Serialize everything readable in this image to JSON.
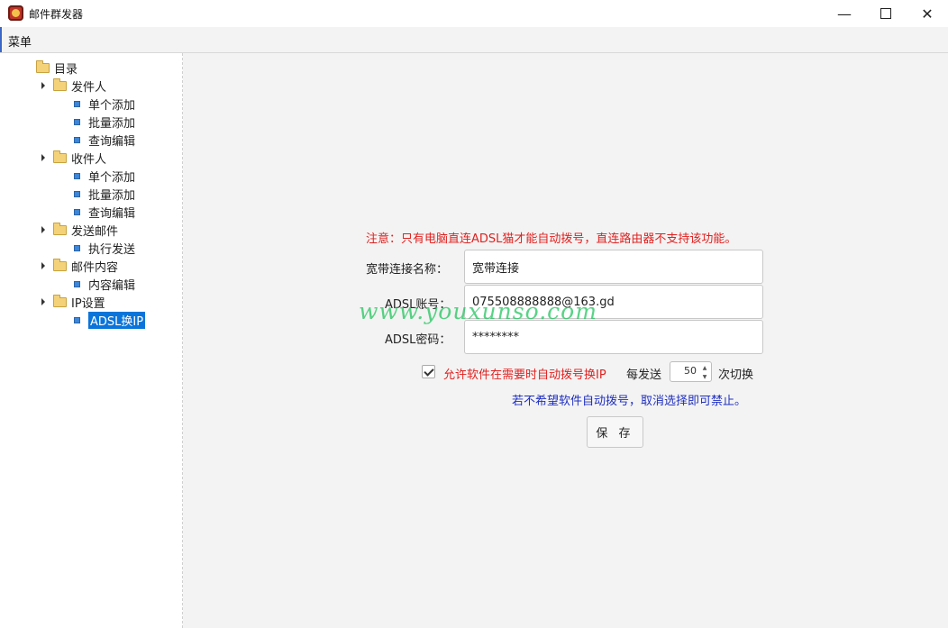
{
  "window": {
    "title": "邮件群发器",
    "minimize_icon": "minimize-icon",
    "maximize_icon": "maximize-icon",
    "close_icon": "close-icon"
  },
  "menubar": {
    "menu_label": "菜单"
  },
  "tree": {
    "root_label": "目录",
    "groups": [
      {
        "label": "发件人",
        "items": [
          "单个添加",
          "批量添加",
          "查询编辑"
        ]
      },
      {
        "label": "收件人",
        "items": [
          "单个添加",
          "批量添加",
          "查询编辑"
        ]
      },
      {
        "label": "发送邮件",
        "items": [
          "执行发送"
        ]
      },
      {
        "label": "邮件内容",
        "items": [
          "内容编辑"
        ]
      },
      {
        "label": "IP设置",
        "items": [
          "ADSL换IP"
        ]
      }
    ],
    "selected": "ADSL换IP"
  },
  "form": {
    "notice": "注意：只有电脑直连ADSL猫才能自动拨号，直连路由器不支持该功能。",
    "connection_name_label": "宽带连接名称：",
    "connection_name_value": "宽带连接",
    "account_label": "ADSL账号：",
    "account_value": "075508888888@163.gd",
    "password_label": "ADSL密码：",
    "password_value": "********",
    "auto_dial_checked": true,
    "auto_dial_label": "允许软件在需要时自动拨号换IP",
    "every_send_label": "每发送",
    "switch_count": "50",
    "switch_unit_label": "次切换",
    "hint": "若不希望软件自动拨号，取消选择即可禁止。",
    "save_label": "保 存"
  },
  "watermark": "www.youxunso.com",
  "colors": {
    "notice_red": "#e0211f",
    "hint_blue": "#1f2fbf",
    "selection_blue": "#0a74da",
    "watermark_green": "#22c55e"
  }
}
